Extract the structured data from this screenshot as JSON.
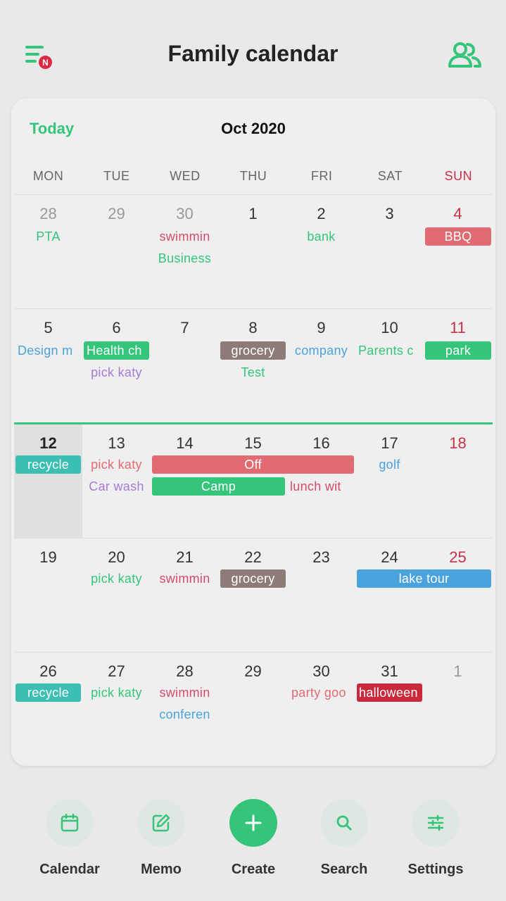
{
  "header": {
    "title": "Family calendar",
    "menu_badge": "N"
  },
  "calendar": {
    "today_label": "Today",
    "month_label": "Oct 2020",
    "weekdays": [
      "MON",
      "TUE",
      "WED",
      "THU",
      "FRI",
      "SAT",
      "SUN"
    ],
    "weeks": [
      {
        "days": [
          "28",
          "29",
          "30",
          "1",
          "2",
          "3",
          "4"
        ],
        "events": [
          "PTA",
          "swimmin",
          "Business",
          "bank",
          "BBQ"
        ]
      },
      {
        "days": [
          "5",
          "6",
          "7",
          "8",
          "9",
          "10",
          "11"
        ],
        "events": [
          "Design m",
          "Health ch",
          "pick katy",
          "grocery",
          "Test",
          "company",
          "Parents c",
          "park"
        ]
      },
      {
        "days": [
          "12",
          "13",
          "14",
          "15",
          "16",
          "17",
          "18"
        ],
        "events": [
          "recycle",
          "pick katy",
          "Car wash",
          "Off",
          "Camp",
          "lunch wit",
          "golf"
        ]
      },
      {
        "days": [
          "19",
          "20",
          "21",
          "22",
          "23",
          "24",
          "25"
        ],
        "events": [
          "pick katy",
          "swimmin",
          "grocery",
          "lake tour"
        ]
      },
      {
        "days": [
          "26",
          "27",
          "28",
          "29",
          "30",
          "31",
          "1"
        ],
        "events": [
          "recycle",
          "pick katy",
          "swimmin",
          "conferen",
          "party goo",
          "halloween"
        ]
      }
    ]
  },
  "nav": {
    "items": [
      {
        "label": "Calendar",
        "icon": "calendar-icon"
      },
      {
        "label": "Memo",
        "icon": "edit-icon"
      },
      {
        "label": "Create",
        "icon": "plus-icon"
      },
      {
        "label": "Search",
        "icon": "search-icon"
      },
      {
        "label": "Settings",
        "icon": "sliders-icon"
      }
    ]
  },
  "colors": {
    "accent_green": "#35c57a",
    "sunday_red": "#c83048",
    "event_pink": "#d64a6b",
    "event_blue": "#4aa3dc",
    "event_purple": "#a57bd6",
    "event_teal": "#3cbfb3",
    "bar_red": "#e06b72",
    "bar_brown": "#8c7b76",
    "bar_darkred": "#c82a3c"
  }
}
